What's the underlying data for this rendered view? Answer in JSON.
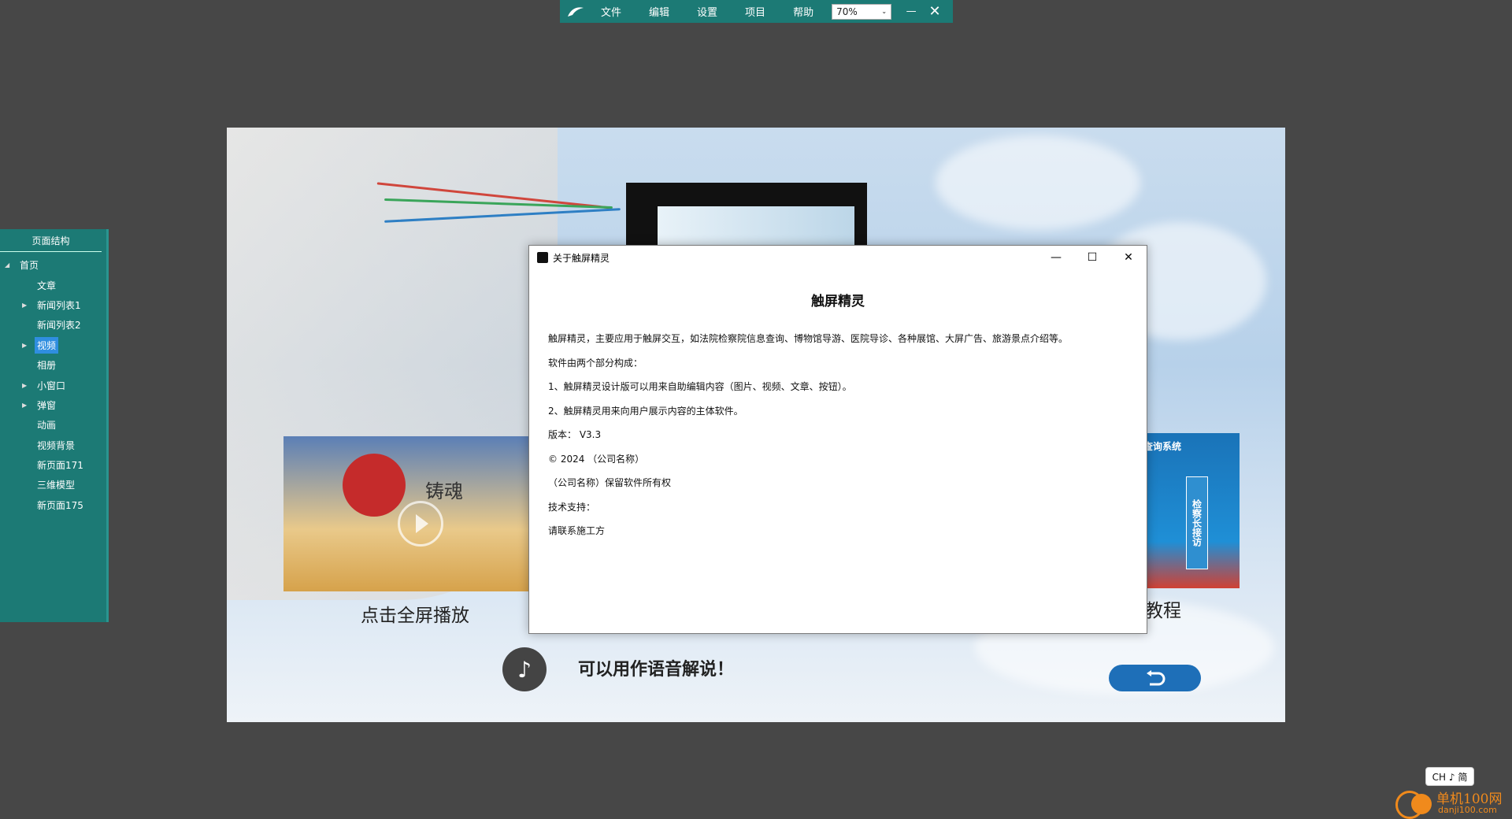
{
  "topbar": {
    "menu": [
      "文件",
      "编辑",
      "设置",
      "项目",
      "帮助"
    ],
    "zoom": "70%"
  },
  "sidebar": {
    "title": "页面结构",
    "items": [
      {
        "label": "首页",
        "level": 0,
        "expandable": true,
        "selected": false
      },
      {
        "label": "文章",
        "level": 1,
        "expandable": false,
        "selected": false
      },
      {
        "label": "新闻列表1",
        "level": 1,
        "expandable": true,
        "selected": false
      },
      {
        "label": "新闻列表2",
        "level": 1,
        "expandable": false,
        "selected": false
      },
      {
        "label": "视频",
        "level": 1,
        "expandable": true,
        "selected": true
      },
      {
        "label": "相册",
        "level": 1,
        "expandable": false,
        "selected": false
      },
      {
        "label": "小窗口",
        "level": 1,
        "expandable": true,
        "selected": false
      },
      {
        "label": "弹窗",
        "level": 1,
        "expandable": true,
        "selected": false
      },
      {
        "label": "动画",
        "level": 1,
        "expandable": false,
        "selected": false
      },
      {
        "label": "视频背景",
        "level": 1,
        "expandable": false,
        "selected": false
      },
      {
        "label": "新页面171",
        "level": 1,
        "expandable": false,
        "selected": false
      },
      {
        "label": "三维模型",
        "level": 1,
        "expandable": false,
        "selected": false
      },
      {
        "label": "新页面175",
        "level": 1,
        "expandable": false,
        "selected": false
      }
    ]
  },
  "canvas": {
    "left_caption": "点击全屏播放",
    "left_card_text": "铸魂",
    "right_caption": "教程",
    "right_card_header": "查询系统",
    "right_card_tile": "检察长接访",
    "voice_text": "可以用作语音解说！"
  },
  "dialog": {
    "title": "关于触屏精灵",
    "heading": "触屏精灵",
    "lines": [
      "触屏精灵，主要应用于触屏交互，如法院检察院信息查询、博物馆导游、医院导诊、各种展馆、大屏广告、旅游景点介绍等。",
      "软件由两个部分构成：",
      "1、触屏精灵设计版可以用来自助编辑内容（图片、视频、文章、按钮）。",
      "2、触屏精灵用来向用户展示内容的主体软件。",
      "版本： V3.3",
      "© 2024 （公司名称）",
      "（公司名称）保留软件所有权",
      "技术支持：",
      "请联系施工方"
    ]
  },
  "ime": {
    "label": "CH ♪ 简"
  },
  "watermark": {
    "title": "单机100网",
    "url": "danji100.com"
  },
  "colors": {
    "toolbar_bg": "#1c7a75",
    "sidebar_bg": "#1c7a75",
    "selection": "#2f8ee0",
    "desktop_bg": "#474747",
    "back_button": "#1e6fb8"
  },
  "icons": [
    "app-logo-icon",
    "minimize-icon",
    "close-icon",
    "expand-arrow-icon",
    "play-icon",
    "music-note-icon",
    "back-arrow-icon",
    "maximize-icon"
  ]
}
